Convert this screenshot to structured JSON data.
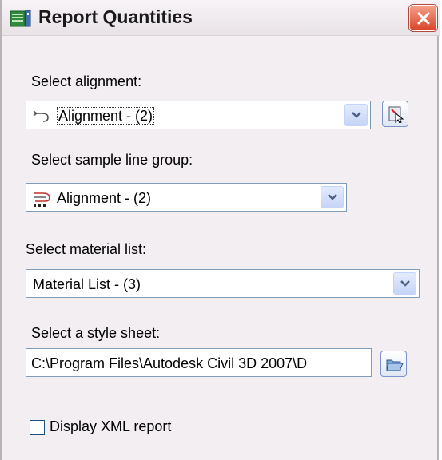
{
  "window": {
    "title": "Report Quantities"
  },
  "alignment": {
    "label": "Select alignment:",
    "value": "Alignment - (2)"
  },
  "sample_line_group": {
    "label": "Select sample line group:",
    "value": "Alignment - (2)"
  },
  "material_list": {
    "label": "Select material list:",
    "value": "Material List - (3)"
  },
  "style_sheet": {
    "label": "Select a style sheet:",
    "value": "C:\\Program Files\\Autodesk Civil 3D 2007\\D"
  },
  "display_xml": {
    "label": "Display XML report",
    "checked": false
  },
  "colors": {
    "close_button": "#d9432b",
    "combo_border": "#7f9db9",
    "dropdown_button": "#c5d4f7"
  }
}
